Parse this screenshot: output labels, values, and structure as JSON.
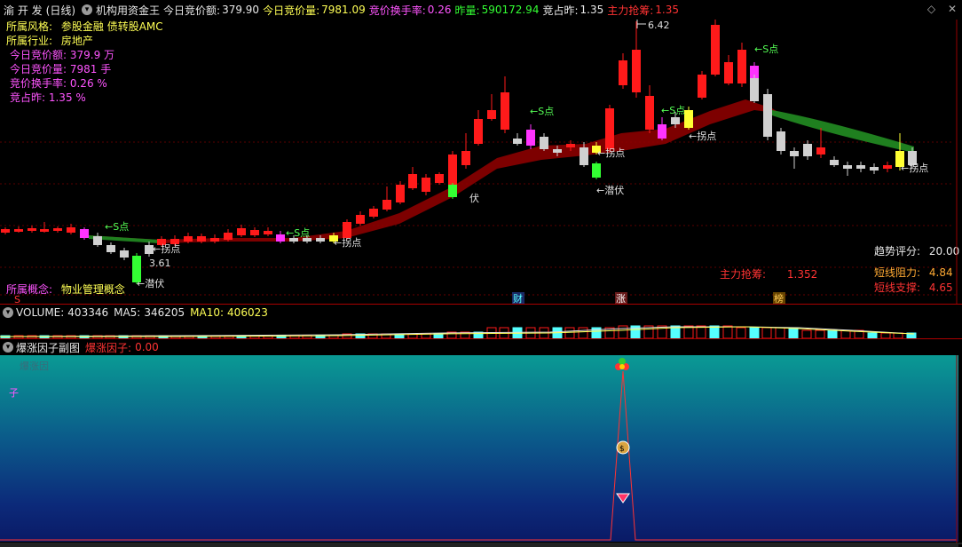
{
  "header": {
    "stock": "渝 开 发",
    "period": "(日线)",
    "indicator_name": "机构用资金王",
    "auction_amount_label": "今日竞价额:",
    "auction_amount_value": "379.90",
    "auction_volume_label": "今日竞价量:",
    "auction_volume_value": "7981.09",
    "turnover_label": "竞价换手率:",
    "turnover_value": "0.26",
    "prev_volume_label": "昨量:",
    "prev_volume_value": "590172.94",
    "ratio_label": "竞占昨:",
    "ratio_value": "1.35",
    "main_force_label": "主力抢筹:",
    "main_force_value": "1.35"
  },
  "info": {
    "style_label": "所属风格:",
    "style_value": "参股金融 债转股AMC",
    "industry_label": "所属行业:",
    "industry_value": "房地产",
    "amount_line": "今日竞价额: 379.9 万",
    "volume_line": "今日竞价量: 7981 手",
    "turnover_line": "竞价换手率: 0.26 %",
    "ratio_line": "竞占昨: 1.35 %",
    "concept_label": "所属概念:",
    "concept_value": "物业管理概念"
  },
  "right_panel": {
    "trend_label": "趋势评分:",
    "trend_value": "20.00",
    "main_force_label": "主力抢筹:",
    "main_force_value": "1.352",
    "resistance_label": "短线阻力:",
    "resistance_value": "4.84",
    "support_label": "短线支撑:",
    "support_value": "4.65"
  },
  "chart_labels": {
    "high": "6.42",
    "low": "3.61",
    "s_point": "S点",
    "turn_point": "拐点",
    "ambush": "潜伏",
    "ambush_partial": "伏",
    "mark_s": "S",
    "mark_cai": "财",
    "mark_zhang": "涨",
    "mark_bang": "榜"
  },
  "volume_panel": {
    "label": "VOLUME:",
    "value": "403346",
    "ma5_label": "MA5:",
    "ma5_value": "346205",
    "ma10_label": "MA10:",
    "ma10_value": "406023"
  },
  "factor_panel": {
    "title": "爆涨因子副图",
    "factor_label": "爆涨因子:",
    "factor_value": "0.00",
    "ghost_text": "爆涨因",
    "side_char": "子"
  },
  "colors": {
    "up": "#ff1a1a",
    "down": "#d0d0d0",
    "ribbon": "#8b0000",
    "ribbon_green": "#1a7a1a",
    "bg": "#000000"
  },
  "chart_data": {
    "type": "candlestick",
    "high": 6.42,
    "low": 3.61,
    "resistance": 4.84,
    "support": 4.65
  }
}
